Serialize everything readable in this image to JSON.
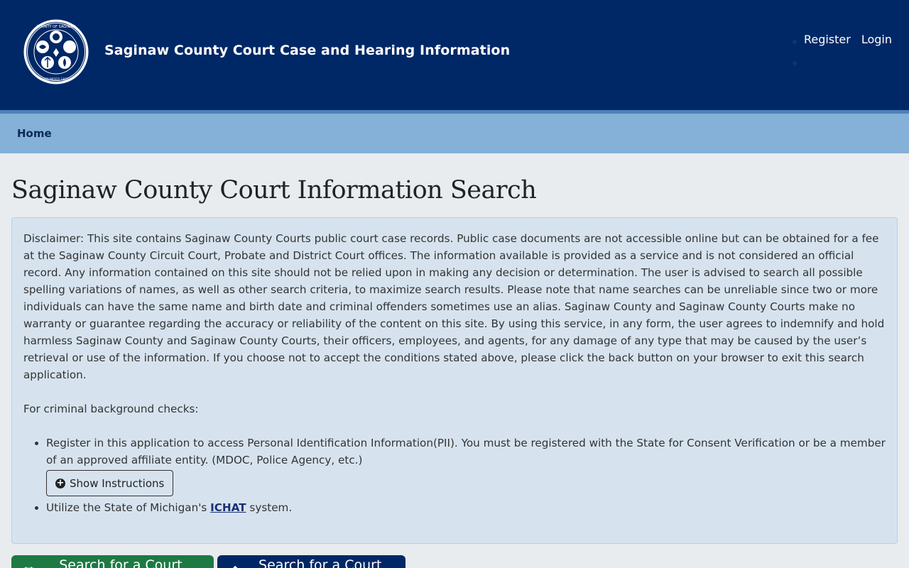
{
  "header": {
    "title": "Saginaw County Court Case and Hearing Information",
    "seal_text_top": "COUNTY OF SAGINAW",
    "seal_text_bottom": "FOUNDED 1835",
    "nav": {
      "register": "Register",
      "login": "Login"
    }
  },
  "navbar": {
    "home": "Home"
  },
  "main": {
    "heading": "Saginaw County Court Information Search",
    "disclaimer": "Disclaimer: This site contains Saginaw County Courts public court case records. Public case documents are not accessible online but can be obtained for a fee at the Saginaw County Circuit Court, Probate and District Court offices. The information available is provided as a service and is not considered an official record. Any information contained on this site should not be relied upon in making any decision or determination. The user is advised to search all possible spelling variations of names, as well as other search criteria, to maximize search results. Please note that name searches can be unreliable since two or more individuals can have the same name and birth date and criminal offenders sometimes use an alias. Saginaw County and Saginaw County Courts make no warranty or guarantee regarding the accuracy or reliability of the content on this site. By using this service, in any form, the user agrees to indemnify and hold harmless Saginaw County and Saginaw County Courts, their officers, employees, and agents, for any damage of any type that may be caused by the user’s retrieval or use of the information. If you choose not to accept the conditions stated above, please click the back button on your browser to exit this search application.",
    "background_heading": "For criminal background checks:",
    "bullet1": "Register in this application to access Personal Identification Information(PII). You must be registered with the State for Consent Verification or be a member of an approved affiliate entity. (MDOC, Police Agency, etc.)",
    "show_instructions": "Show Instructions",
    "bullet2_prefix": "Utilize the State of Michigan's ",
    "bullet2_link": "ICHAT",
    "bullet2_suffix": " system.",
    "btn_docket": "Search for a Court Docket",
    "btn_case": "Search for a Court Case"
  },
  "colors": {
    "header_bg": "#002866",
    "navbar_bg": "#85b0d8",
    "docket_button": "#1d7a44",
    "case_button": "#002866"
  },
  "icons": {
    "seal": "county-seal-icon",
    "show_instructions": "plus-circle-icon",
    "docket": "calendar-icon",
    "case": "gavel-icon"
  }
}
